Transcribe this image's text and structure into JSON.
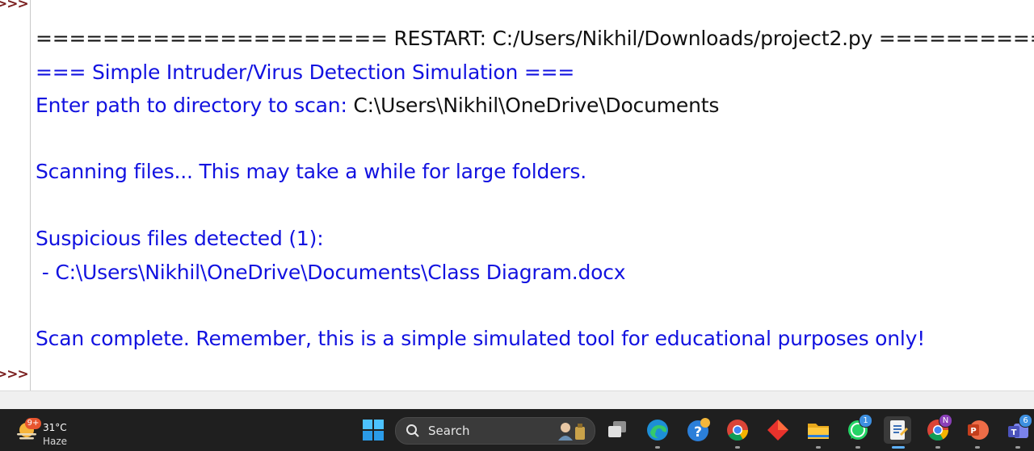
{
  "shell": {
    "prompt": ">>>",
    "lines": [
      {
        "text": "===================== RESTART: C:/Users/Nikhil/Downloads/project2.py ============",
        "kind": "std"
      },
      {
        "text": "=== Simple Intruder/Virus Detection Simulation ===",
        "kind": "out"
      },
      {
        "prefix": "Enter path to directory to scan: ",
        "input": "C:\\Users\\Nikhil\\OneDrive\\Documents"
      },
      {
        "text": "Scanning files... This may take a while for large folders.",
        "kind": "out"
      },
      {
        "text": "Suspicious files detected (1):",
        "kind": "out"
      },
      {
        "text": " - C:\\Users\\Nikhil\\OneDrive\\Documents\\Class Diagram.docx",
        "kind": "out"
      },
      {
        "text": "Scan complete. Remember, this is a simple simulated tool for educational purposes only!",
        "kind": "out"
      }
    ]
  },
  "taskbar": {
    "weather": {
      "badge": "9+",
      "temp": "31°C",
      "condition": "Haze"
    },
    "search": {
      "placeholder": "Search"
    },
    "badges": {
      "whatsapp": "1",
      "chrome_profile": "N",
      "teams": "6"
    }
  },
  "colors": {
    "output": "#1212e0",
    "stdin": "#111111",
    "prompt": "#7a1f1f",
    "taskbar": "#1f1f1f"
  }
}
